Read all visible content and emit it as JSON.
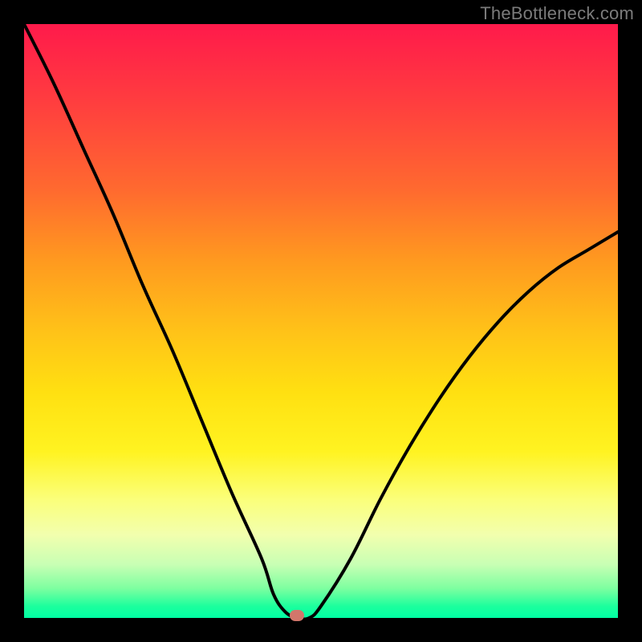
{
  "watermark": "TheBottleneck.com",
  "colors": {
    "frame": "#000000",
    "curve": "#000000",
    "marker": "#d2766b",
    "gradient_top": "#ff1a4b",
    "gradient_bottom": "#00ffa3"
  },
  "chart_data": {
    "type": "line",
    "title": "",
    "xlabel": "",
    "ylabel": "",
    "xlim": [
      0,
      100
    ],
    "ylim": [
      0,
      100
    ],
    "grid": false,
    "legend": false,
    "series": [
      {
        "name": "bottleneck-curve",
        "x": [
          0,
          5,
          10,
          15,
          20,
          25,
          30,
          35,
          40,
          42,
          44,
          46,
          48,
          50,
          55,
          60,
          65,
          70,
          75,
          80,
          85,
          90,
          95,
          100
        ],
        "values": [
          100,
          90,
          79,
          68,
          56,
          45,
          33,
          21,
          10,
          4,
          1,
          0,
          0,
          2,
          10,
          20,
          29,
          37,
          44,
          50,
          55,
          59,
          62,
          65
        ]
      }
    ],
    "marker": {
      "x": 46,
      "y": 0
    },
    "background_gradient": {
      "orientation": "vertical",
      "stops": [
        {
          "pos": 0.0,
          "color": "#ff1a4b"
        },
        {
          "pos": 0.4,
          "color": "#ff9a1f"
        },
        {
          "pos": 0.65,
          "color": "#ffe011"
        },
        {
          "pos": 0.85,
          "color": "#f2ffae"
        },
        {
          "pos": 1.0,
          "color": "#00ffa3"
        }
      ]
    }
  }
}
